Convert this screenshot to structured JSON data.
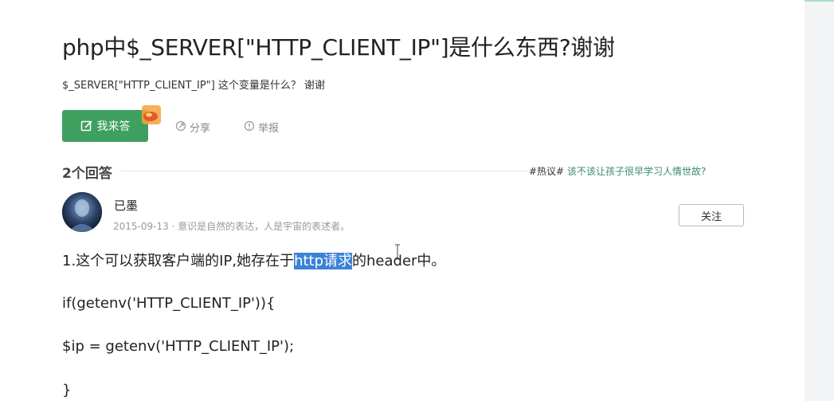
{
  "question": {
    "title": "php中$_SERVER[\"HTTP_CLIENT_IP\"]是什么东西?谢谢",
    "description": "$_SERVER[\"HTTP_CLIENT_IP\"] 这个变量是什么？ 谢谢"
  },
  "actions": {
    "answer_label": "我来答",
    "share_label": "分享",
    "report_label": "举报"
  },
  "answers_header": {
    "count_label": "2个回答",
    "hot_tag": "#热议#",
    "hot_link": "该不该让孩子很早学习人情世故?"
  },
  "answer": {
    "author": "已墨",
    "meta": "2015-09-13 · 意识是自然的表达，人是宇宙的表述者。",
    "follow_label": "关注",
    "line1_before": "1.这个可以获取客户端的IP,她存在于",
    "line1_highlight": "http请求",
    "line1_after": "的header中。",
    "code_line1": "if(getenv('HTTP_CLIENT_IP')){",
    "code_line2": "$ip = getenv('HTTP_CLIENT_IP');",
    "code_line3": "}"
  },
  "colors": {
    "accent_green": "#3ea05f",
    "link_green": "#3a8c68",
    "selection_blue": "#3b82d6"
  },
  "icons": [
    "edit-icon",
    "share-icon",
    "report-icon",
    "reward-badge-icon",
    "text-cursor-icon"
  ]
}
